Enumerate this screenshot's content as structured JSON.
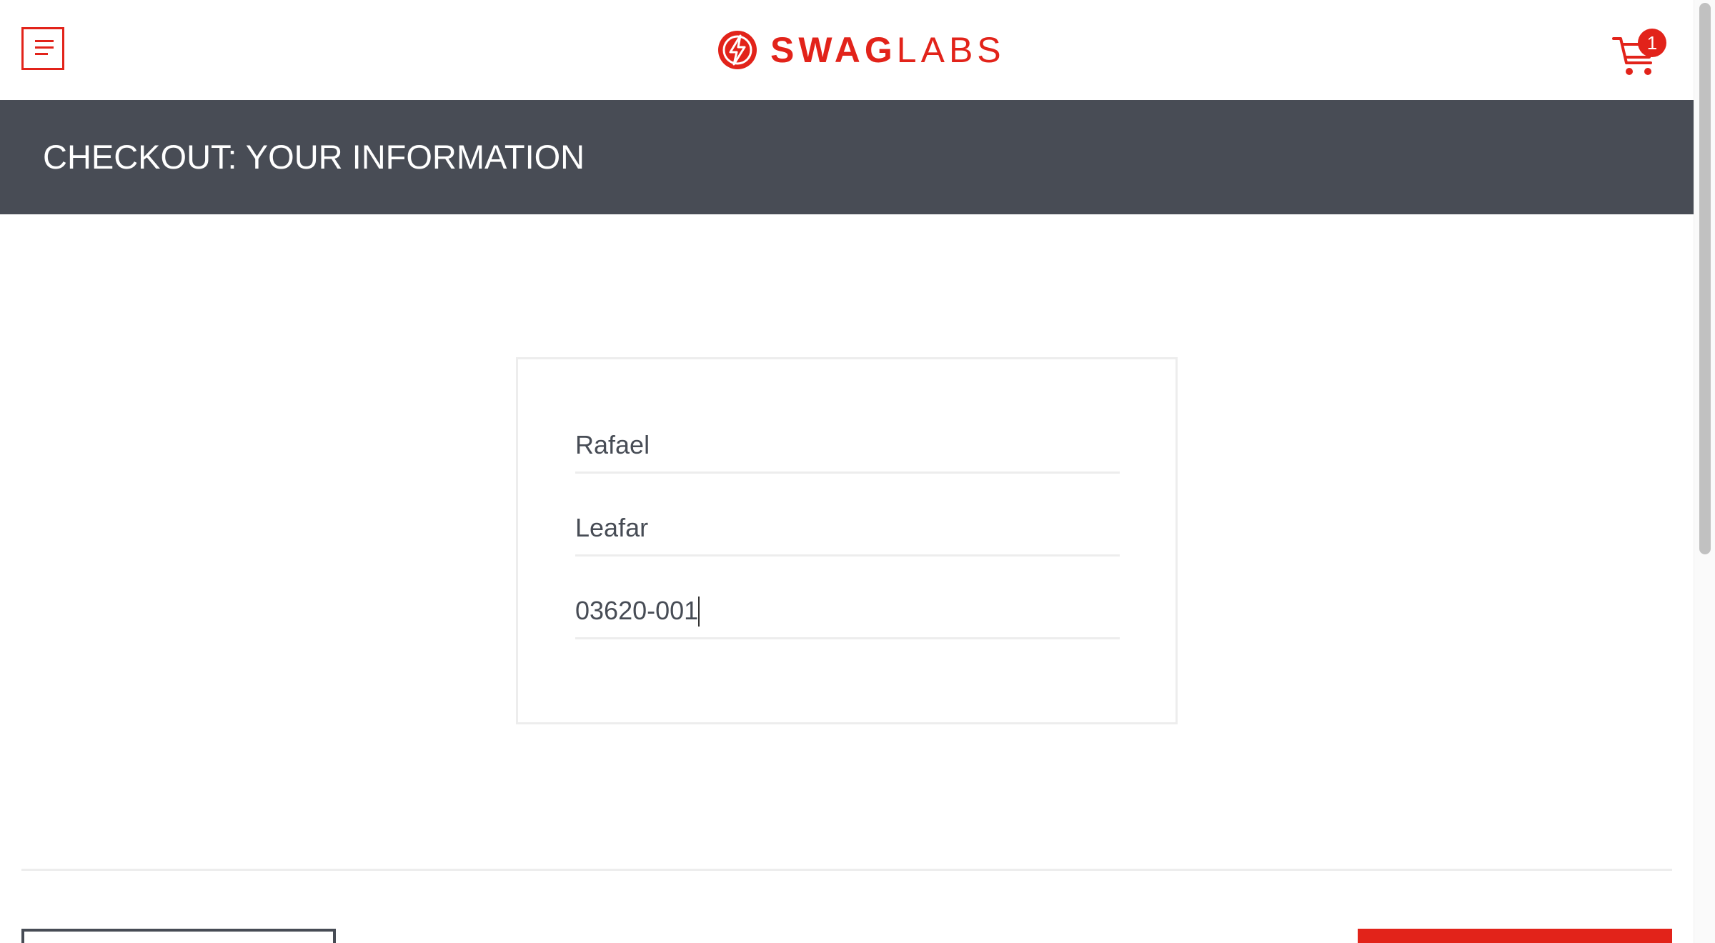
{
  "header": {
    "menu_icon": "hamburger-menu-icon",
    "logo": {
      "bold": "SWAG",
      "light": "LABS"
    },
    "cart": {
      "icon": "shopping-cart-icon",
      "badge_count": "1"
    }
  },
  "page": {
    "title": "CHECKOUT: YOUR INFORMATION"
  },
  "form": {
    "first_name": {
      "value": "Rafael"
    },
    "last_name": {
      "value": "Leafar"
    },
    "postal_code": {
      "value": "03620-001"
    }
  },
  "colors": {
    "accent": "#e2231a",
    "title_bar": "#484c55",
    "text": "#474c55",
    "border": "#ededed"
  }
}
